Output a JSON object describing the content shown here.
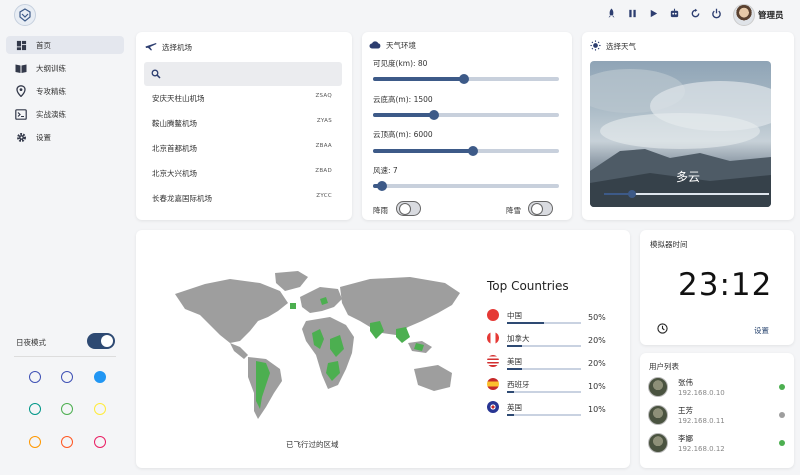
{
  "header": {
    "username": "管理员",
    "icons": [
      "rocket-icon",
      "pause-icon",
      "play-icon",
      "robot-icon",
      "refresh-icon",
      "power-icon"
    ]
  },
  "sidebar": {
    "items": [
      {
        "label": "首页",
        "icon": "dashboard-icon",
        "active": true
      },
      {
        "label": "大纲训练",
        "icon": "book-icon",
        "active": false
      },
      {
        "label": "专攻精练",
        "icon": "location-pin-icon",
        "active": false
      },
      {
        "label": "实战演练",
        "icon": "terminal-icon",
        "active": false
      },
      {
        "label": "设置",
        "icon": "gear-icon",
        "active": false
      }
    ],
    "night_mode_label": "日夜模式",
    "night_mode_on": true,
    "theme_colors": [
      [
        "#3f51b5",
        "#3f51b5",
        "#2196f3"
      ],
      [
        "#009688",
        "#4caf50",
        "#ffeb3b"
      ],
      [
        "#ff9800",
        "#ff5722",
        "#e91e63"
      ]
    ]
  },
  "airport_panel": {
    "title": "选择机场",
    "search_placeholder": "",
    "airports": [
      {
        "name": "安庆天柱山机场",
        "code": "ZSAQ"
      },
      {
        "name": "鞍山腾鳌机场",
        "code": "ZYAS"
      },
      {
        "name": "北京首都机场",
        "code": "ZBAA"
      },
      {
        "name": "北京大兴机场",
        "code": "ZBAD"
      },
      {
        "name": "长春龙嘉国际机场",
        "code": "ZYCC"
      }
    ]
  },
  "weather_env": {
    "title": "天气环境",
    "sliders": [
      {
        "label": "可见度(km): 80",
        "fraction": 0.49
      },
      {
        "label": "云底高(m): 1500",
        "fraction": 0.33
      },
      {
        "label": "云顶高(m): 6000",
        "fraction": 0.54
      },
      {
        "label": "风速: 7",
        "fraction": 0.05
      }
    ],
    "rain_label": "降雨",
    "snow_label": "降雪",
    "rain_on": false,
    "snow_on": false
  },
  "weather_select": {
    "title": "选择天气",
    "current": "多云",
    "level": 0.17
  },
  "map_panel": {
    "caption": "已飞行过的区域",
    "top_title": "Top Countries",
    "countries": [
      {
        "name": "中国",
        "pct": "50%",
        "value": 0.5,
        "flag": "china-flag-icon"
      },
      {
        "name": "加拿大",
        "pct": "20%",
        "value": 0.2,
        "flag": "canada-flag-icon"
      },
      {
        "name": "美国",
        "pct": "20%",
        "value": 0.2,
        "flag": "usa-flag-icon"
      },
      {
        "name": "西班牙",
        "pct": "10%",
        "value": 0.1,
        "flag": "spain-flag-icon"
      },
      {
        "name": "英国",
        "pct": "10%",
        "value": 0.1,
        "flag": "uk-flag-icon"
      }
    ],
    "colors": {
      "land": "#9e9e9e",
      "visited": "#4caf50"
    }
  },
  "sim_time": {
    "title": "模拟器时间",
    "time": "23:12",
    "settings_label": "设置"
  },
  "users": {
    "title": "用户列表",
    "list": [
      {
        "name": "张伟",
        "ip": "192.168.0.10",
        "status_color": "#4caf50"
      },
      {
        "name": "王芳",
        "ip": "192.168.0.11",
        "status_color": "#9e9e9e"
      },
      {
        "name": "李娜",
        "ip": "192.168.0.12",
        "status_color": "#4caf50"
      }
    ]
  }
}
